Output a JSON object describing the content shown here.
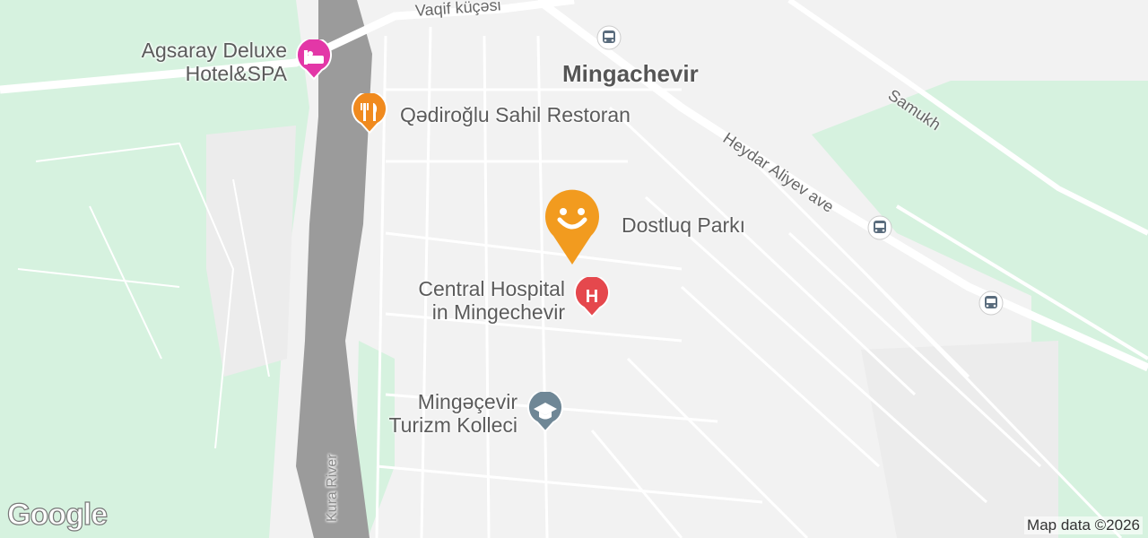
{
  "map": {
    "city_label": "Mingachevir",
    "attribution": "Map data ©2026",
    "logo_text": "Google",
    "roads": [
      {
        "id": "vaqif",
        "name": "Vaqif küçəsi"
      },
      {
        "id": "samukh",
        "name": "Samukh"
      },
      {
        "id": "heydar",
        "name": "Heydar Aliyev ave"
      }
    ],
    "water": {
      "name": "Kura River"
    },
    "pois": [
      {
        "id": "hotel",
        "line1": "Agsaray Deluxe",
        "line2": "Hotel&SPA",
        "icon": "bed-icon",
        "color": "#e337a7"
      },
      {
        "id": "restaurant",
        "line1": "Qədiroğlu Sahil Restoran",
        "icon": "fork-knife-icon",
        "color": "#f08a1e"
      },
      {
        "id": "park",
        "line1": "Dostluq Parkı",
        "icon": "tree-icon",
        "color": "#2f9e55"
      },
      {
        "id": "hospital",
        "line1": "Central Hospital",
        "line2": "in Mingechevir",
        "icon": "hospital-h-icon",
        "color": "#e5484d"
      },
      {
        "id": "college",
        "line1": "Mingəçevir",
        "line2": "Turizm Kolleci",
        "icon": "graduation-cap-icon",
        "color": "#6f8796"
      }
    ],
    "colors": {
      "park": "#d6f2df",
      "river": "#9b9b9b",
      "marker": "#f29b1f"
    }
  }
}
